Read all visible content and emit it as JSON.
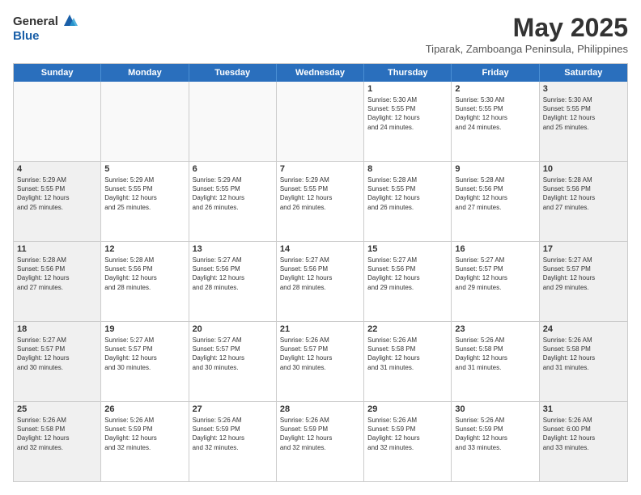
{
  "logo": {
    "general": "General",
    "blue": "Blue"
  },
  "title": "May 2025",
  "subtitle": "Tiparak, Zamboanga Peninsula, Philippines",
  "headers": [
    "Sunday",
    "Monday",
    "Tuesday",
    "Wednesday",
    "Thursday",
    "Friday",
    "Saturday"
  ],
  "rows": [
    [
      {
        "day": "",
        "text": ""
      },
      {
        "day": "",
        "text": ""
      },
      {
        "day": "",
        "text": ""
      },
      {
        "day": "",
        "text": ""
      },
      {
        "day": "1",
        "text": "Sunrise: 5:30 AM\nSunset: 5:55 PM\nDaylight: 12 hours\nand 24 minutes."
      },
      {
        "day": "2",
        "text": "Sunrise: 5:30 AM\nSunset: 5:55 PM\nDaylight: 12 hours\nand 24 minutes."
      },
      {
        "day": "3",
        "text": "Sunrise: 5:30 AM\nSunset: 5:55 PM\nDaylight: 12 hours\nand 25 minutes."
      }
    ],
    [
      {
        "day": "4",
        "text": "Sunrise: 5:29 AM\nSunset: 5:55 PM\nDaylight: 12 hours\nand 25 minutes."
      },
      {
        "day": "5",
        "text": "Sunrise: 5:29 AM\nSunset: 5:55 PM\nDaylight: 12 hours\nand 25 minutes."
      },
      {
        "day": "6",
        "text": "Sunrise: 5:29 AM\nSunset: 5:55 PM\nDaylight: 12 hours\nand 26 minutes."
      },
      {
        "day": "7",
        "text": "Sunrise: 5:29 AM\nSunset: 5:55 PM\nDaylight: 12 hours\nand 26 minutes."
      },
      {
        "day": "8",
        "text": "Sunrise: 5:28 AM\nSunset: 5:55 PM\nDaylight: 12 hours\nand 26 minutes."
      },
      {
        "day": "9",
        "text": "Sunrise: 5:28 AM\nSunset: 5:56 PM\nDaylight: 12 hours\nand 27 minutes."
      },
      {
        "day": "10",
        "text": "Sunrise: 5:28 AM\nSunset: 5:56 PM\nDaylight: 12 hours\nand 27 minutes."
      }
    ],
    [
      {
        "day": "11",
        "text": "Sunrise: 5:28 AM\nSunset: 5:56 PM\nDaylight: 12 hours\nand 27 minutes."
      },
      {
        "day": "12",
        "text": "Sunrise: 5:28 AM\nSunset: 5:56 PM\nDaylight: 12 hours\nand 28 minutes."
      },
      {
        "day": "13",
        "text": "Sunrise: 5:27 AM\nSunset: 5:56 PM\nDaylight: 12 hours\nand 28 minutes."
      },
      {
        "day": "14",
        "text": "Sunrise: 5:27 AM\nSunset: 5:56 PM\nDaylight: 12 hours\nand 28 minutes."
      },
      {
        "day": "15",
        "text": "Sunrise: 5:27 AM\nSunset: 5:56 PM\nDaylight: 12 hours\nand 29 minutes."
      },
      {
        "day": "16",
        "text": "Sunrise: 5:27 AM\nSunset: 5:57 PM\nDaylight: 12 hours\nand 29 minutes."
      },
      {
        "day": "17",
        "text": "Sunrise: 5:27 AM\nSunset: 5:57 PM\nDaylight: 12 hours\nand 29 minutes."
      }
    ],
    [
      {
        "day": "18",
        "text": "Sunrise: 5:27 AM\nSunset: 5:57 PM\nDaylight: 12 hours\nand 30 minutes."
      },
      {
        "day": "19",
        "text": "Sunrise: 5:27 AM\nSunset: 5:57 PM\nDaylight: 12 hours\nand 30 minutes."
      },
      {
        "day": "20",
        "text": "Sunrise: 5:27 AM\nSunset: 5:57 PM\nDaylight: 12 hours\nand 30 minutes."
      },
      {
        "day": "21",
        "text": "Sunrise: 5:26 AM\nSunset: 5:57 PM\nDaylight: 12 hours\nand 30 minutes."
      },
      {
        "day": "22",
        "text": "Sunrise: 5:26 AM\nSunset: 5:58 PM\nDaylight: 12 hours\nand 31 minutes."
      },
      {
        "day": "23",
        "text": "Sunrise: 5:26 AM\nSunset: 5:58 PM\nDaylight: 12 hours\nand 31 minutes."
      },
      {
        "day": "24",
        "text": "Sunrise: 5:26 AM\nSunset: 5:58 PM\nDaylight: 12 hours\nand 31 minutes."
      }
    ],
    [
      {
        "day": "25",
        "text": "Sunrise: 5:26 AM\nSunset: 5:58 PM\nDaylight: 12 hours\nand 32 minutes."
      },
      {
        "day": "26",
        "text": "Sunrise: 5:26 AM\nSunset: 5:59 PM\nDaylight: 12 hours\nand 32 minutes."
      },
      {
        "day": "27",
        "text": "Sunrise: 5:26 AM\nSunset: 5:59 PM\nDaylight: 12 hours\nand 32 minutes."
      },
      {
        "day": "28",
        "text": "Sunrise: 5:26 AM\nSunset: 5:59 PM\nDaylight: 12 hours\nand 32 minutes."
      },
      {
        "day": "29",
        "text": "Sunrise: 5:26 AM\nSunset: 5:59 PM\nDaylight: 12 hours\nand 32 minutes."
      },
      {
        "day": "30",
        "text": "Sunrise: 5:26 AM\nSunset: 5:59 PM\nDaylight: 12 hours\nand 33 minutes."
      },
      {
        "day": "31",
        "text": "Sunrise: 5:26 AM\nSunset: 6:00 PM\nDaylight: 12 hours\nand 33 minutes."
      }
    ]
  ]
}
